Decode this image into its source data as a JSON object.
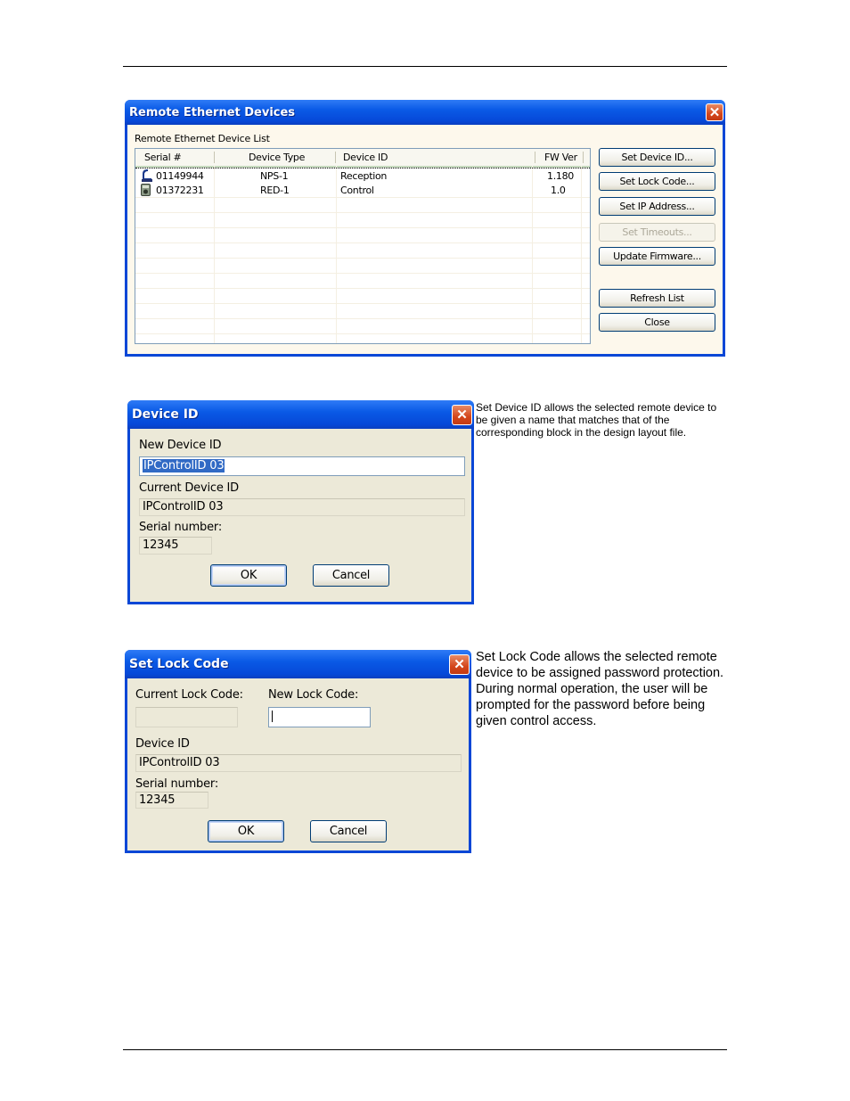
{
  "remote_devices_window": {
    "title": "Remote Ethernet Devices",
    "list_label": "Remote Ethernet Device List",
    "columns": [
      "Serial #",
      "Device Type",
      "Device ID",
      "FW Ver"
    ],
    "rows": [
      {
        "icon": "nps-device-icon",
        "serial": "01149944",
        "type": "NPS-1",
        "device_id": "Reception",
        "fw": "1.180"
      },
      {
        "icon": "red-remote-icon",
        "serial": "01372231",
        "type": "RED-1",
        "device_id": "Control",
        "fw": "1.0"
      }
    ],
    "buttons": {
      "set_device_id": "Set Device ID...",
      "set_lock_code": "Set Lock Code...",
      "set_ip_address": "Set IP Address...",
      "set_timeouts": "Set Timeouts...",
      "update_firmware": "Update Firmware...",
      "refresh_list": "Refresh List",
      "close": "Close"
    }
  },
  "device_id_dialog": {
    "title": "Device ID",
    "new_label": "New Device ID",
    "new_value": "IPControlID 03",
    "current_label": "Current Device ID",
    "current_value": "IPControlID 03",
    "serial_label": "Serial number:",
    "serial_value": "12345",
    "ok": "OK",
    "cancel": "Cancel",
    "description": "Set Device ID allows the selected remote device to be given a name that matches that of the corresponding block in the design layout file."
  },
  "lock_code_dialog": {
    "title": "Set Lock Code",
    "current_label": "Current Lock Code:",
    "current_value": "",
    "new_label": "New Lock Code:",
    "new_value": "",
    "device_id_label": "Device ID",
    "device_id_value": "IPControlID 03",
    "serial_label": "Serial number:",
    "serial_value": "12345",
    "ok": "OK",
    "cancel": "Cancel",
    "description": "Set Lock Code allows the selected remote device to be assigned password protection. During normal operation, the user will be prompted for the password before being given control access."
  },
  "close_glyph": "✕"
}
